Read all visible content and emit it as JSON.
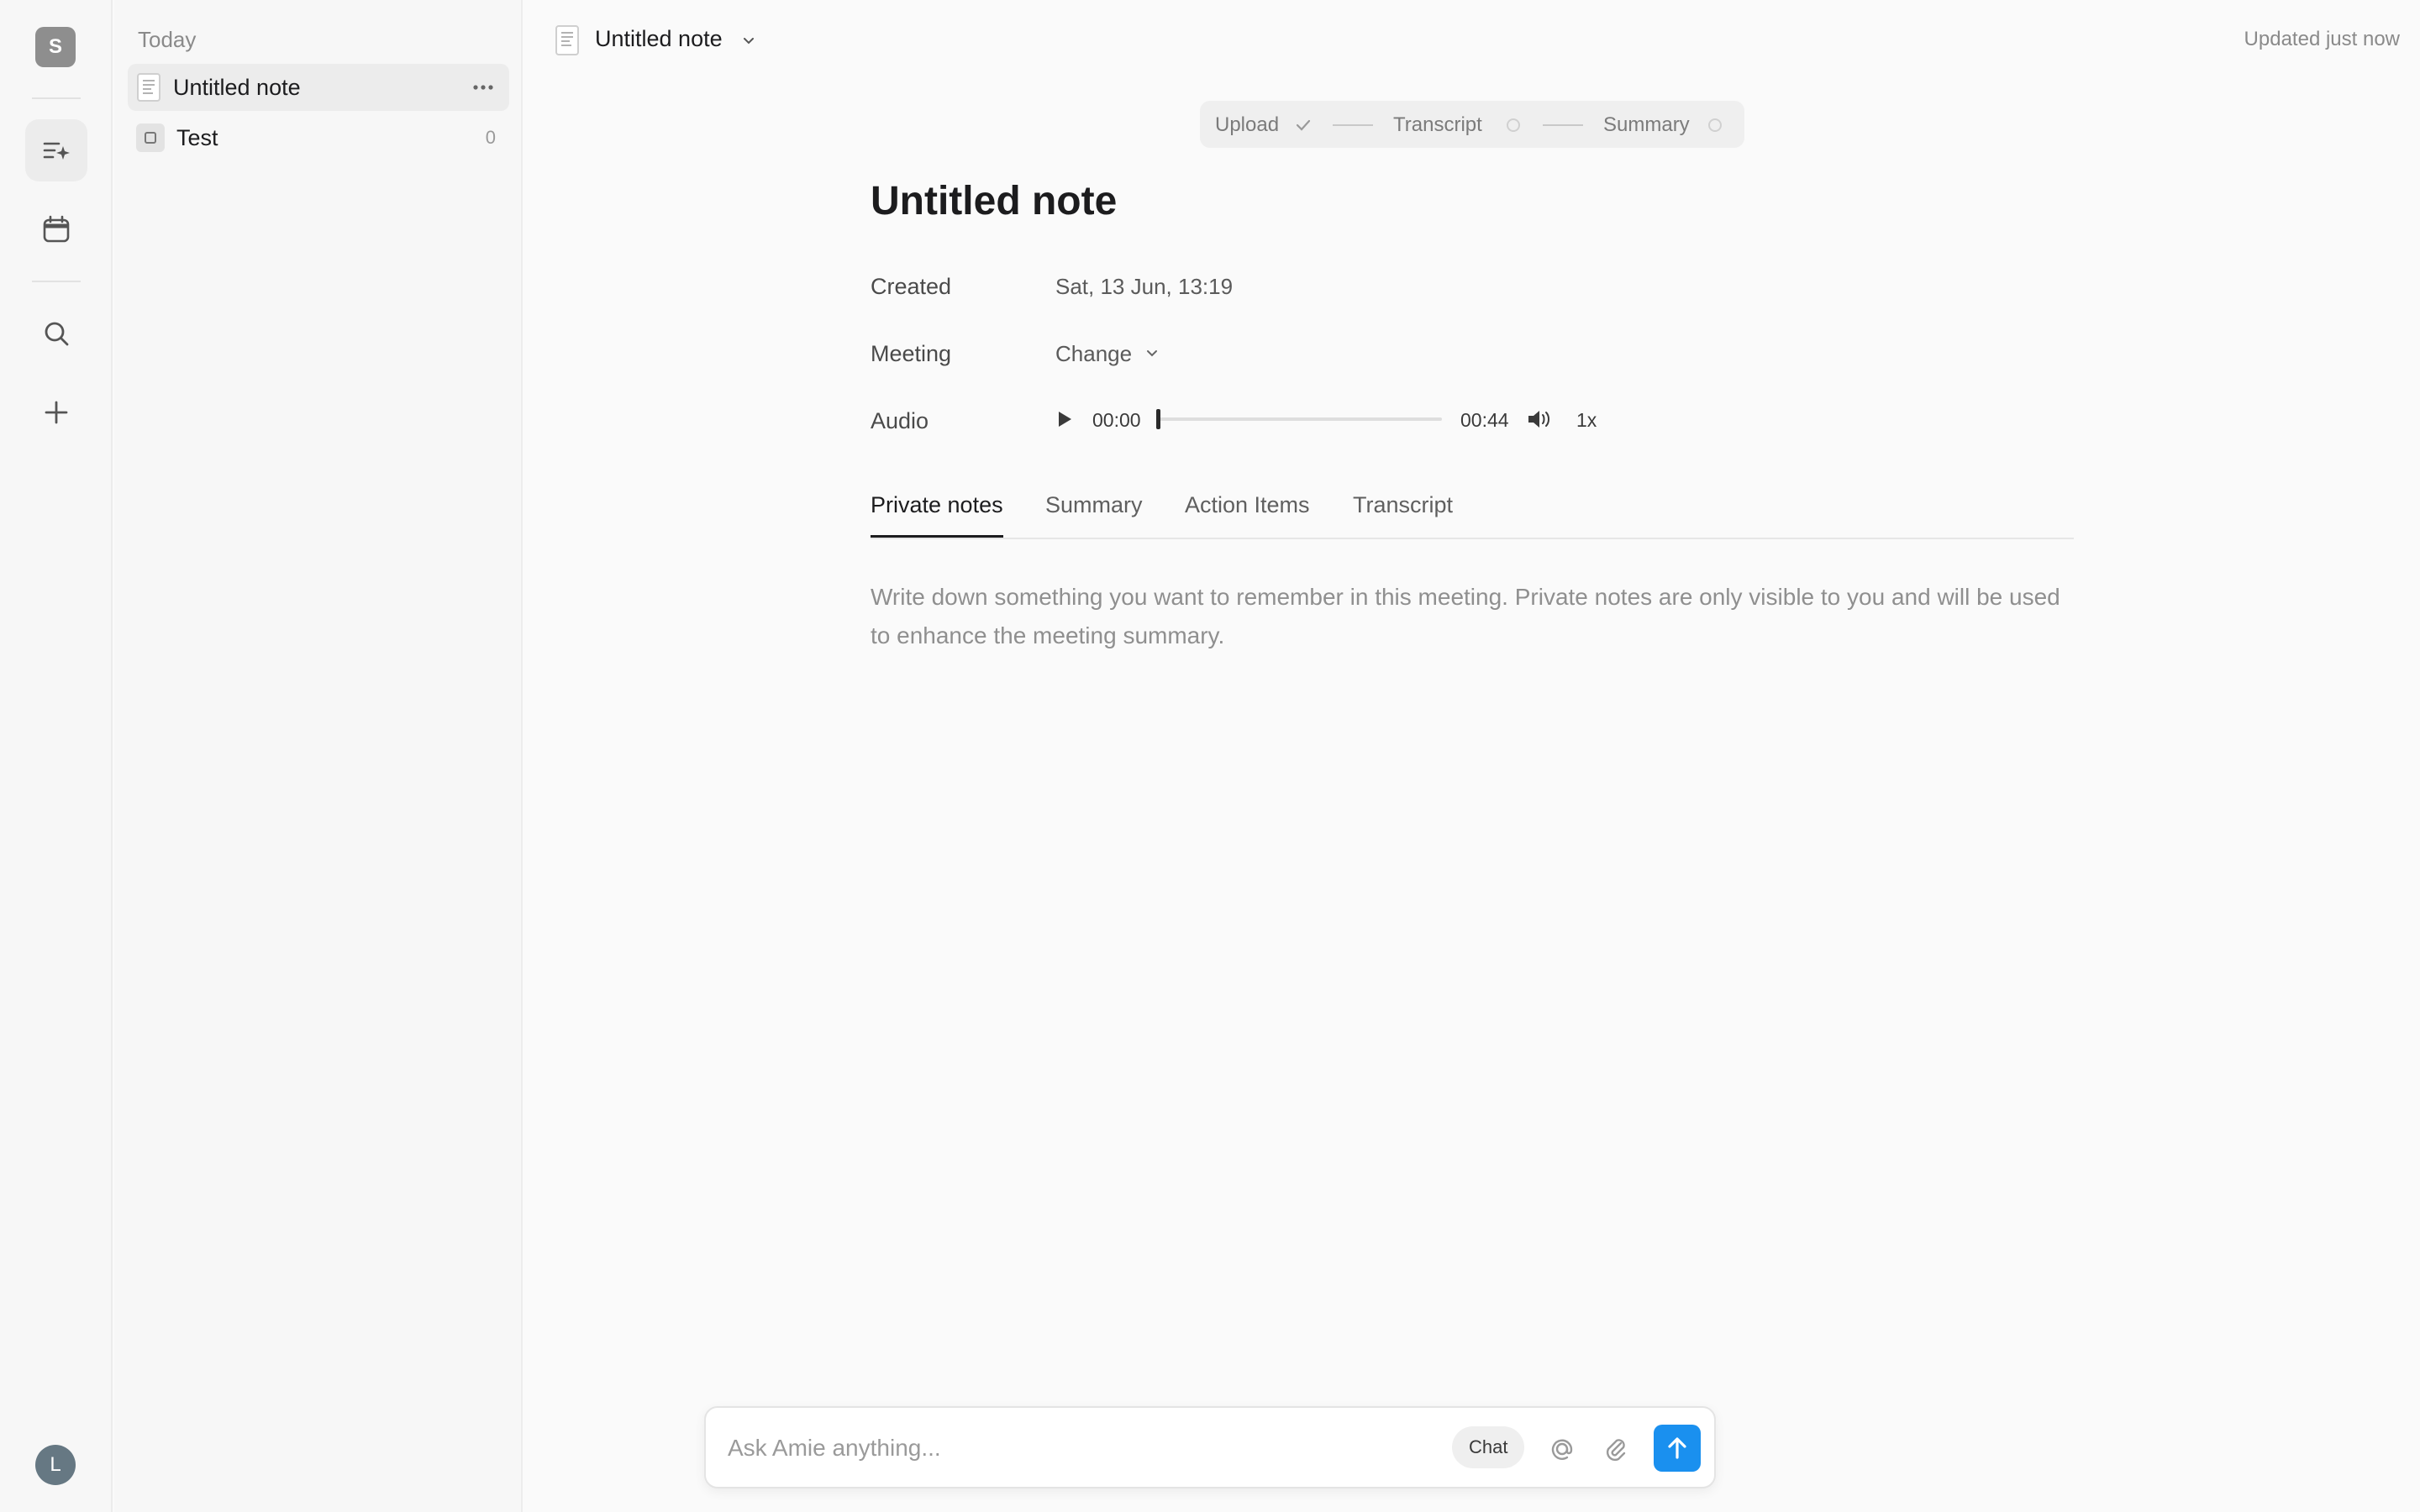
{
  "app": {
    "workspace_initial": "S",
    "user_initial": "L"
  },
  "rail": {
    "items": [
      {
        "name": "notes",
        "icon": "notes-sparkle-icon",
        "active": true
      },
      {
        "name": "calendar",
        "icon": "calendar-icon",
        "active": false
      },
      {
        "name": "search",
        "icon": "search-icon",
        "active": false
      },
      {
        "name": "new",
        "icon": "plus-icon",
        "active": false
      }
    ]
  },
  "list": {
    "heading": "Today",
    "items": [
      {
        "label": "Untitled note",
        "icon": "document-icon",
        "selected": true
      },
      {
        "label": "Test",
        "icon": "folder-square-icon",
        "count": "0"
      }
    ]
  },
  "topbar": {
    "doc_title": "Untitled note",
    "updated": "Updated just now"
  },
  "steps": {
    "upload": "Upload",
    "transcript": "Transcript",
    "summary": "Summary"
  },
  "note": {
    "title": "Untitled note",
    "created_label": "Created",
    "created_value": "Sat, 13 Jun, 13:19",
    "meeting_label": "Meeting",
    "meeting_value": "Change",
    "audio_label": "Audio"
  },
  "audio": {
    "current_time": "00:00",
    "duration": "00:44",
    "speed": "1x",
    "progress": 0
  },
  "tabs": [
    {
      "label": "Private notes",
      "active": true
    },
    {
      "label": "Summary",
      "active": false
    },
    {
      "label": "Action Items",
      "active": false
    },
    {
      "label": "Transcript",
      "active": false
    }
  ],
  "editor": {
    "placeholder": "Write down something you want to remember in this meeting. Private notes are only visible to you and will be used to enhance the meeting summary."
  },
  "chat": {
    "placeholder": "Ask Amie anything...",
    "mode": "Chat"
  },
  "colors": {
    "accent": "#1a90ef",
    "avatar": "#667883"
  }
}
